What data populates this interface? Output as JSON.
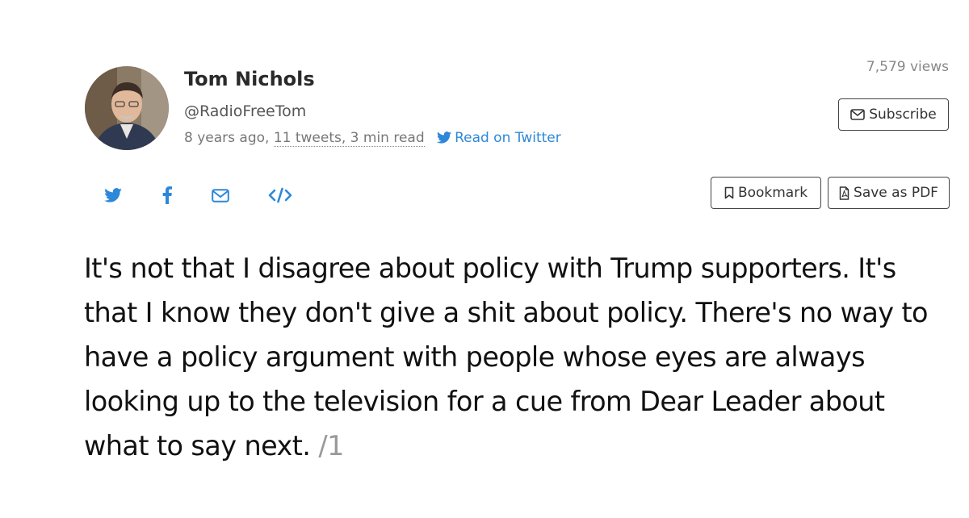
{
  "author": {
    "name": "Tom Nichols",
    "handle": "@RadioFreeTom",
    "posted": "8 years ago,",
    "tweet_info": "11 tweets, 3 min read",
    "read_on_twitter": "Read on Twitter"
  },
  "views": "7,579 views",
  "buttons": {
    "subscribe": "Subscribe",
    "bookmark": "Bookmark",
    "save_pdf": "Save as PDF"
  },
  "share_icons": [
    "twitter-icon",
    "facebook-icon",
    "mail-icon",
    "embed-icon"
  ],
  "colors": {
    "accent": "#2d88d9",
    "muted": "#777777",
    "text": "#111111"
  },
  "tweet": {
    "text": "It's not that I disagree about policy with Trump supporters. It's that I know they don't give a shit about policy. There's no way to have a policy argument with people whose eyes are always looking up to the television for a cue from Dear Leader about what to say next.",
    "number": "/1"
  }
}
